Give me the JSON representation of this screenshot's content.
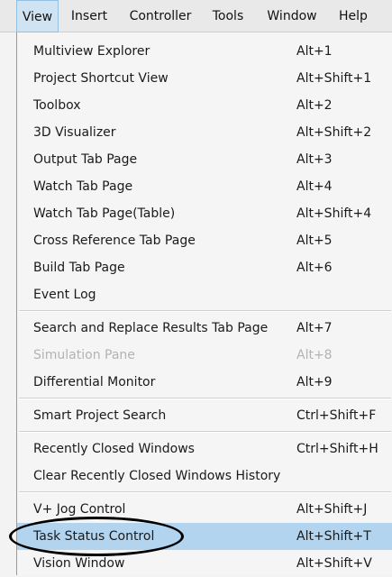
{
  "menubar": {
    "items": [
      {
        "label": "View"
      },
      {
        "label": "Insert"
      },
      {
        "label": "Controller"
      },
      {
        "label": "Tools"
      },
      {
        "label": "Window"
      },
      {
        "label": "Help"
      }
    ],
    "active_index": 0
  },
  "view_menu": {
    "items": [
      {
        "label": "Multiview Explorer",
        "shortcut": "Alt+1"
      },
      {
        "label": "Project Shortcut View",
        "shortcut": "Alt+Shift+1"
      },
      {
        "label": "Toolbox",
        "shortcut": "Alt+2"
      },
      {
        "label": "3D Visualizer",
        "shortcut": "Alt+Shift+2"
      },
      {
        "label": "Output Tab Page",
        "shortcut": "Alt+3"
      },
      {
        "label": "Watch Tab Page",
        "shortcut": "Alt+4"
      },
      {
        "label": "Watch Tab Page(Table)",
        "shortcut": "Alt+Shift+4"
      },
      {
        "label": "Cross Reference Tab Page",
        "shortcut": "Alt+5"
      },
      {
        "label": "Build Tab Page",
        "shortcut": "Alt+6"
      },
      {
        "label": "Event Log",
        "shortcut": ""
      },
      {
        "label": "Search and Replace Results Tab Page",
        "shortcut": "Alt+7"
      },
      {
        "label": "Simulation Pane",
        "shortcut": "Alt+8",
        "disabled": true
      },
      {
        "label": "Differential Monitor",
        "shortcut": "Alt+9"
      },
      {
        "label": "Smart Project Search",
        "shortcut": "Ctrl+Shift+F"
      },
      {
        "label": "Recently Closed Windows",
        "shortcut": "Ctrl+Shift+H"
      },
      {
        "label": "Clear Recently Closed Windows History",
        "shortcut": ""
      },
      {
        "label": "V+ Jog Control",
        "shortcut": "Alt+Shift+J"
      },
      {
        "label": "Task Status Control",
        "shortcut": "Alt+Shift+T",
        "highlighted": true,
        "circled": true
      },
      {
        "label": "Vision Window",
        "shortcut": "Alt+Shift+V"
      }
    ]
  },
  "colors": {
    "highlight": "#b3d4ef",
    "menubar_active": "#cfe3f3",
    "disabled_text": "#b3b3b3",
    "annotation": "#000000"
  }
}
